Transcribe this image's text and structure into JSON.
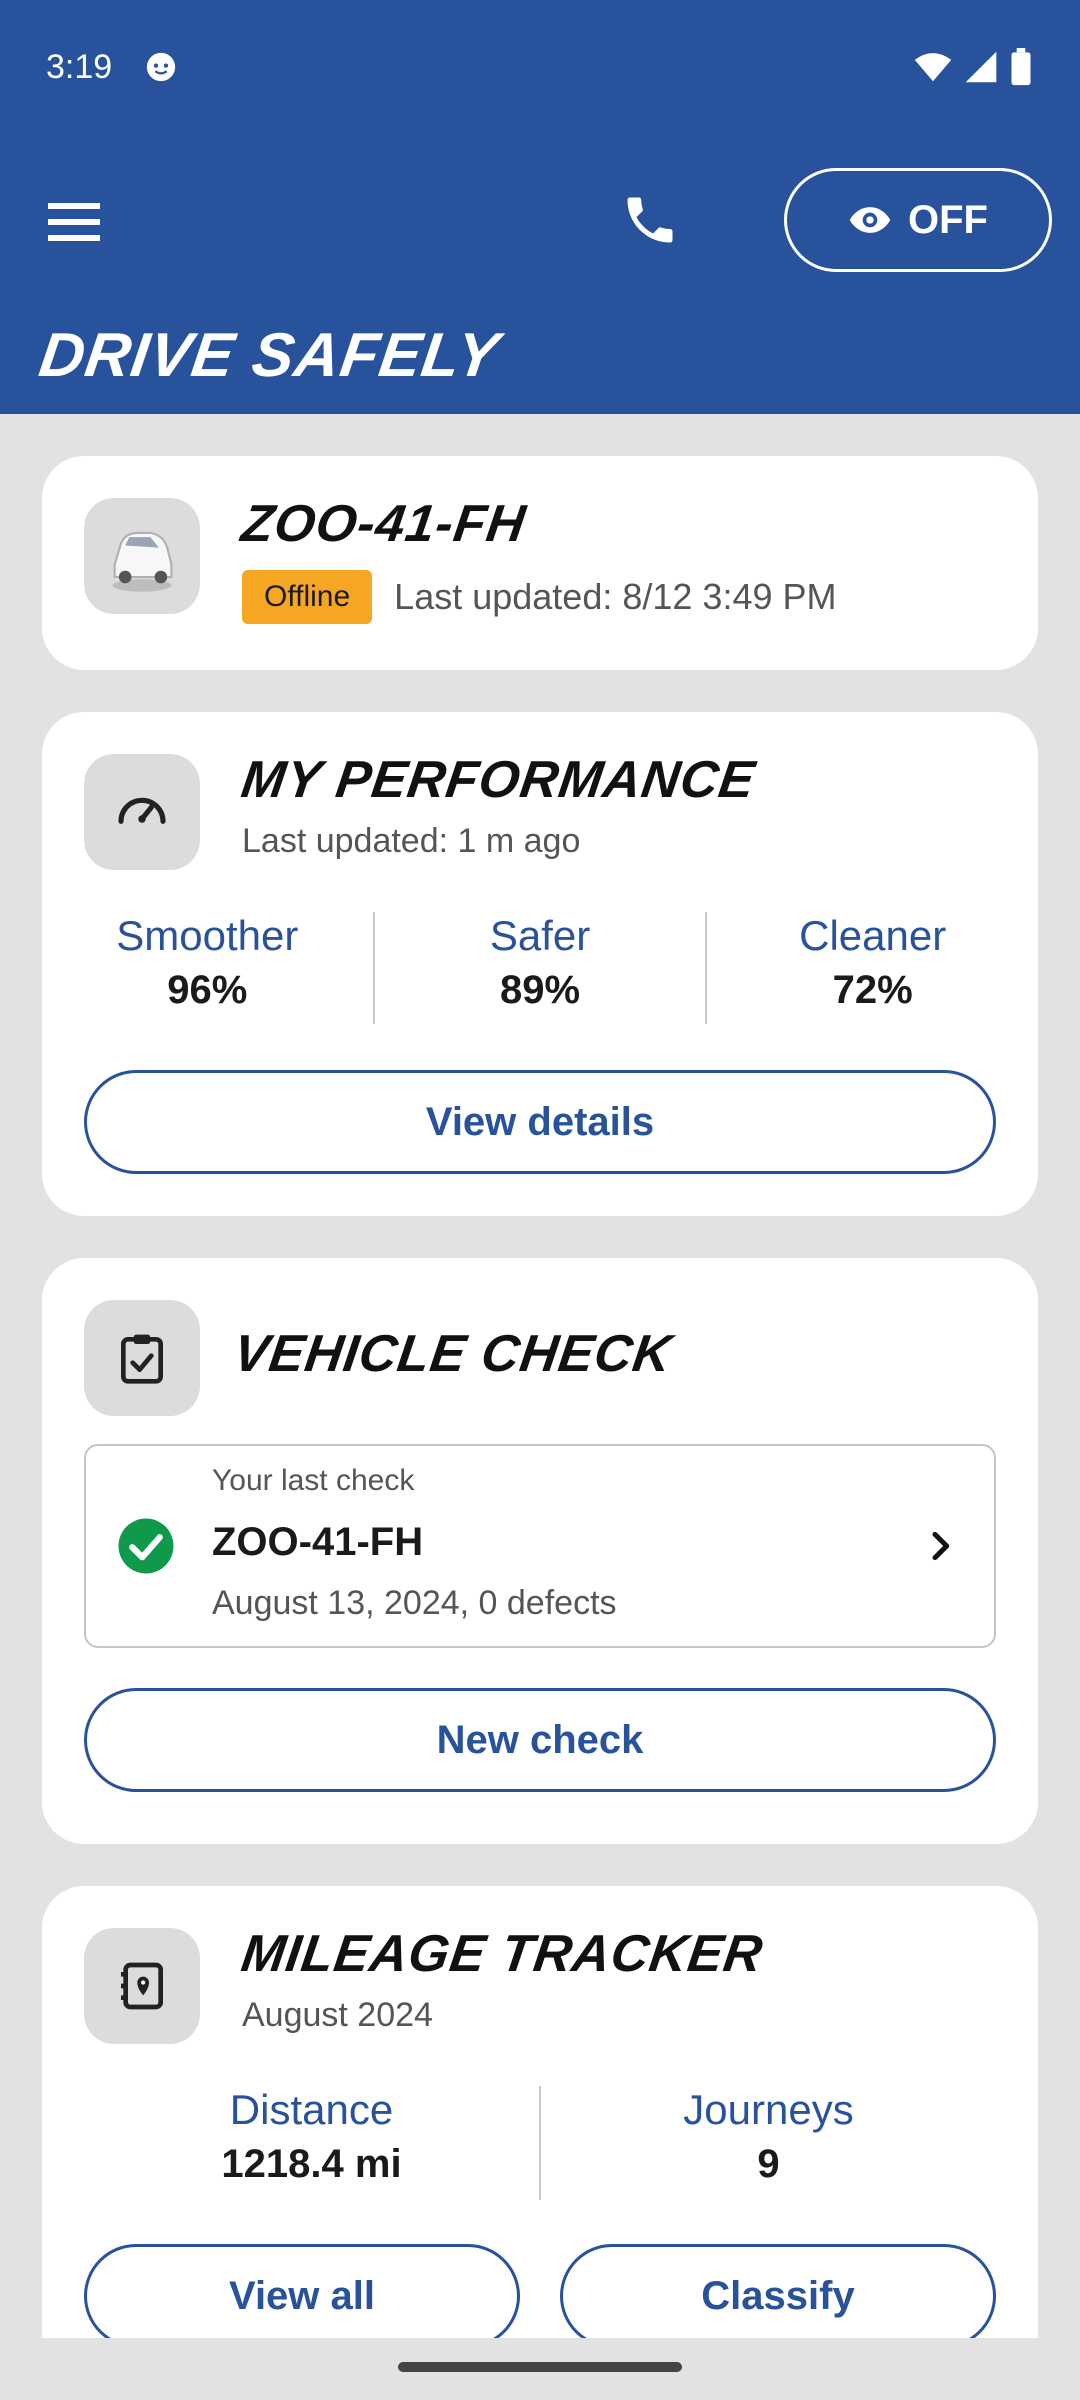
{
  "status_bar": {
    "time": "3:19"
  },
  "header": {
    "eye_toggle_label": "OFF",
    "brand_title": "DRIVE SAFELY"
  },
  "vehicle_card": {
    "plate": "ZOO-41-FH",
    "status_badge": "Offline",
    "last_updated": "Last updated: 8/12 3:49 PM"
  },
  "performance_card": {
    "title": "MY PERFORMANCE",
    "last_updated": "Last updated: 1 m ago",
    "stats": [
      {
        "label": "Smoother",
        "value": "96%"
      },
      {
        "label": "Safer",
        "value": "89%"
      },
      {
        "label": "Cleaner",
        "value": "72%"
      }
    ],
    "button_label": "View details"
  },
  "vehicle_check_card": {
    "title": "VEHICLE CHECK",
    "last_check_label": "Your last check",
    "last_check_plate": "ZOO-41-FH",
    "last_check_detail": "August 13, 2024, 0 defects",
    "button_label": "New check"
  },
  "mileage_card": {
    "title": "MILEAGE TRACKER",
    "period": "August 2024",
    "stats": [
      {
        "label": "Distance",
        "value": "1218.4 mi"
      },
      {
        "label": "Journeys",
        "value": "9"
      }
    ],
    "view_all_label": "View all",
    "classify_label": "Classify"
  },
  "colors": {
    "brand_blue": "#28529c",
    "offline_badge": "#f5a623",
    "success_green": "#0e9a4a"
  }
}
